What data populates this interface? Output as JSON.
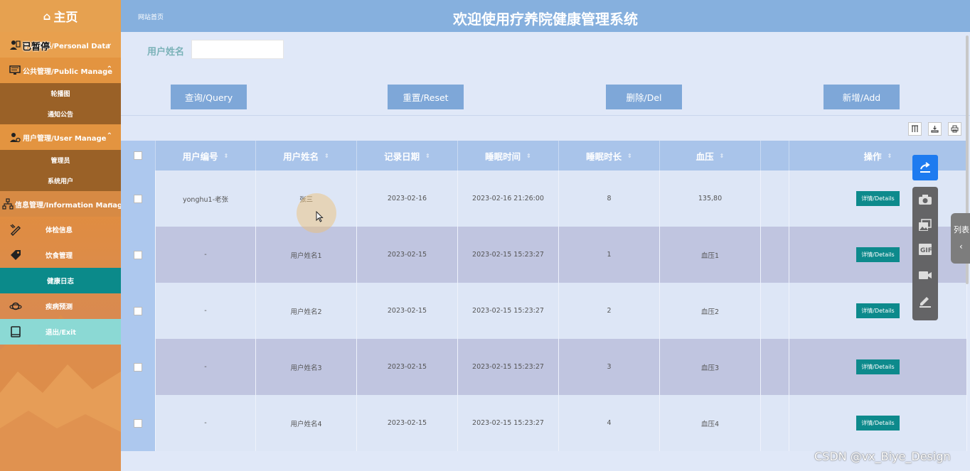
{
  "sidebar": {
    "home_label": "主页",
    "menus": [
      {
        "label": "个人资料/Personal Data",
        "overlay": "已暂停"
      },
      {
        "label": "公共管理/Public Manage",
        "items": [
          "轮播图",
          "通知公告"
        ]
      },
      {
        "label": "用户管理/User Manage",
        "items": [
          "管理员",
          "系统用户"
        ]
      },
      {
        "label": "信息管理/Information Manage"
      }
    ],
    "items": [
      {
        "label": "体检信息"
      },
      {
        "label": "饮食管理"
      },
      {
        "label": "健康日志"
      },
      {
        "label": "疾病预测"
      },
      {
        "label": "退出/Exit"
      }
    ]
  },
  "header": {
    "breadcrumb": "网站首页",
    "title": "欢迎使用疗养院健康管理系统"
  },
  "search": {
    "label": "用户姓名",
    "value": ""
  },
  "actions": {
    "query": "查询/Query",
    "reset": "重置/Reset",
    "delete": "删除/Del",
    "add": "新增/Add"
  },
  "table": {
    "columns": [
      "用户编号",
      "用户姓名",
      "记录日期",
      "睡眠时间",
      "睡眠时长",
      "血压",
      "",
      "操作"
    ],
    "rows": [
      {
        "id": "yonghu1-老张",
        "name": "张三",
        "date": "2023-02-16",
        "sleep_time": "2023-02-16 21:26:00",
        "sleep_hours": "8",
        "bp": "135,80",
        "action": "详情/Details"
      },
      {
        "id": "-",
        "name": "用户姓名1",
        "date": "2023-02-15",
        "sleep_time": "2023-02-15 15:23:27",
        "sleep_hours": "1",
        "bp": "血压1",
        "action": "详情/Details"
      },
      {
        "id": "-",
        "name": "用户姓名2",
        "date": "2023-02-15",
        "sleep_time": "2023-02-15 15:23:27",
        "sleep_hours": "2",
        "bp": "血压2",
        "action": "详情/Details"
      },
      {
        "id": "-",
        "name": "用户姓名3",
        "date": "2023-02-15",
        "sleep_time": "2023-02-15 15:23:27",
        "sleep_hours": "3",
        "bp": "血压3",
        "action": "详情/Details"
      },
      {
        "id": "-",
        "name": "用户姓名4",
        "date": "2023-02-15",
        "sleep_time": "2023-02-15 15:23:27",
        "sleep_hours": "4",
        "bp": "血压4",
        "action": "详情/Details"
      }
    ]
  },
  "side_tab": {
    "label": "列表"
  },
  "watermark": "CSDN @vx_Biye_Design",
  "colors": {
    "accent": "#0d8a8c",
    "header": "#86b0de",
    "sidebar": "#e38e3a"
  }
}
